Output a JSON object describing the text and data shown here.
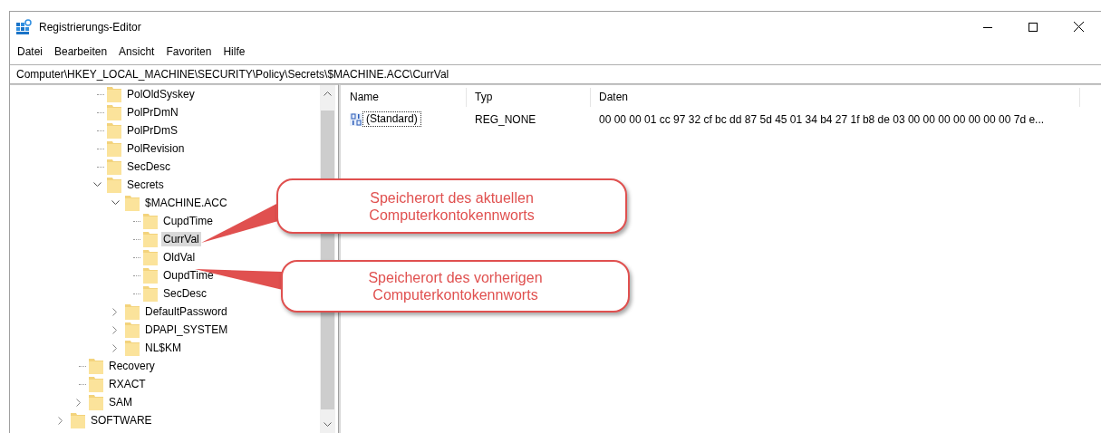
{
  "window": {
    "title": "Registrierungs-Editor"
  },
  "menu": [
    "Datei",
    "Bearbeiten",
    "Ansicht",
    "Favoriten",
    "Hilfe"
  ],
  "address": "Computer\\HKEY_LOCAL_MACHINE\\SECURITY\\Policy\\Secrets\\$MACHINE.ACC\\CurrVal",
  "tree": {
    "items": [
      {
        "children": [
          {
            "children": [
              {
                "label": "PolOldSyskey",
                "selected": false
              },
              {
                "label": "PolPrDmN",
                "selected": false
              },
              {
                "label": "PolPrDmS",
                "selected": false
              },
              {
                "label": "PolRevision",
                "selected": false
              },
              {
                "label": "SecDesc",
                "selected": false
              },
              {
                "label": "Secrets",
                "selected": false,
                "expanded": true,
                "children": [
                  {
                    "label": "$MACHINE.ACC",
                    "selected": false,
                    "expanded": true,
                    "children": [
                      {
                        "label": "CupdTime",
                        "selected": false
                      },
                      {
                        "label": "CurrVal",
                        "selected": true
                      },
                      {
                        "label": "OldVal",
                        "selected": false
                      },
                      {
                        "label": "OupdTime",
                        "selected": false
                      },
                      {
                        "label": "SecDesc",
                        "selected": false
                      }
                    ]
                  },
                  {
                    "label": "DefaultPassword",
                    "selected": false,
                    "expanded": false
                  },
                  {
                    "label": "DPAPI_SYSTEM",
                    "selected": false,
                    "expanded": false
                  },
                  {
                    "label": "NL$KM",
                    "selected": false,
                    "expanded": false
                  }
                ]
              }
            ]
          },
          {
            "label": "Recovery",
            "selected": false
          },
          {
            "label": "RXACT",
            "selected": false
          },
          {
            "label": "SAM",
            "selected": false,
            "expanded": false
          }
        ]
      },
      {
        "label": "SOFTWARE",
        "selected": false,
        "expanded": false
      }
    ]
  },
  "values": {
    "columns": [
      "Name",
      "Typ",
      "Daten"
    ],
    "rows": [
      {
        "name": "(Standard)",
        "type": "REG_NONE",
        "data": "00 00 00 01 cc 97 32 cf bc dd 87 5d 45 01 34 b4 27 1f b8 de 03 00 00 00 00 00 00 00 7d e...",
        "focused": true
      }
    ]
  },
  "callouts": [
    {
      "text": "Speicherort des aktuellen\nComputerkontokennworts"
    },
    {
      "text": "Speicherort des vorherigen\nComputerkontokennworts"
    }
  ]
}
